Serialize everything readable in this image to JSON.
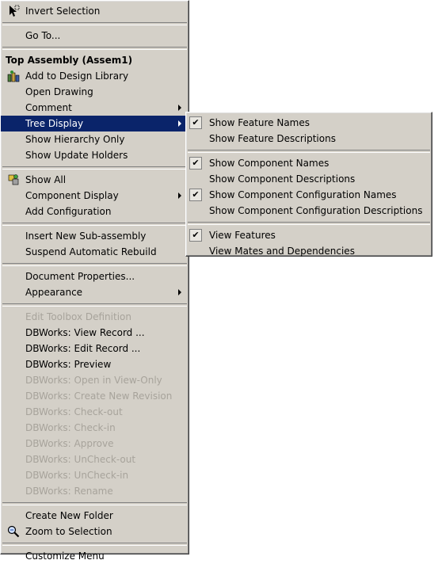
{
  "main_menu": {
    "invert_selection": "Invert Selection",
    "go_to": "Go To...",
    "header": "Top Assembly (Assem1)",
    "add_to_design_library": "Add to Design Library",
    "open_drawing": "Open Drawing",
    "comment": "Comment",
    "tree_display": "Tree Display",
    "show_hierarchy_only": "Show Hierarchy Only",
    "show_update_holders": "Show Update Holders",
    "show_all": "Show All",
    "component_display": "Component Display",
    "add_configuration": "Add Configuration",
    "insert_new_subassembly": "Insert New Sub-assembly",
    "suspend_automatic_rebuild": "Suspend Automatic Rebuild",
    "document_properties": "Document Properties...",
    "appearance": "Appearance",
    "edit_toolbox_definition": "Edit Toolbox Definition",
    "dbworks_view_record": "DBWorks: View Record ...",
    "dbworks_edit_record": "DBWorks: Edit Record ...",
    "dbworks_preview": "DBWorks: Preview",
    "dbworks_open_view_only": "DBWorks: Open in View-Only",
    "dbworks_create_new_revision": "DBWorks: Create New Revision",
    "dbworks_check_out": "DBWorks: Check-out",
    "dbworks_check_in": "DBWorks: Check-in",
    "dbworks_approve": "DBWorks: Approve",
    "dbworks_uncheck_out": "DBWorks: UnCheck-out",
    "dbworks_uncheck_in": "DBWorks: UnCheck-in",
    "dbworks_rename": "DBWorks: Rename",
    "create_new_folder": "Create New Folder",
    "zoom_to_selection": "Zoom to Selection",
    "customize_menu": "Customize Menu"
  },
  "sub_menu": {
    "show_feature_names": "Show Feature Names",
    "show_feature_descriptions": "Show Feature Descriptions",
    "show_component_names": "Show Component Names",
    "show_component_descriptions": "Show Component Descriptions",
    "show_component_configuration_names": "Show Component Configuration Names",
    "show_component_configuration_descriptions": "Show Component Configuration Descriptions",
    "view_features": "View Features",
    "view_mates_and_dependencies": "View Mates and Dependencies"
  },
  "colors": {
    "menu_background": "#d4d0c8",
    "highlight": "#0a246a",
    "disabled_text": "#a7a39b"
  }
}
